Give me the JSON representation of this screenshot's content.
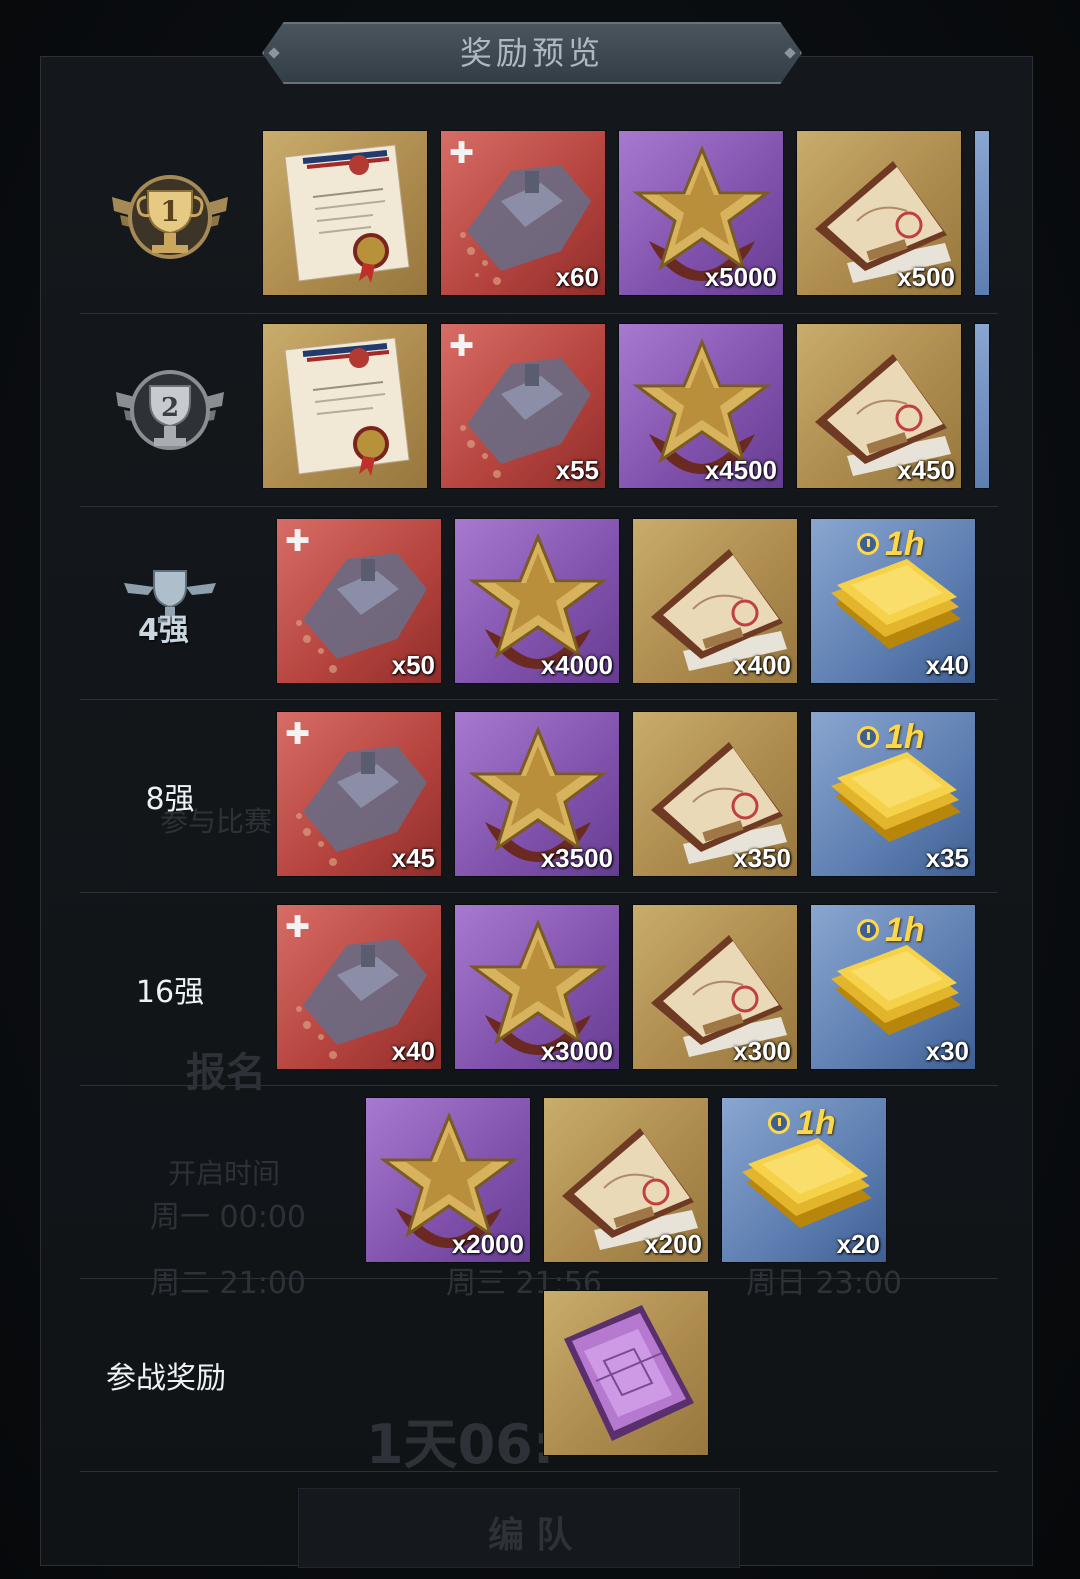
{
  "header": {
    "title": "奖励预览"
  },
  "rows": [
    {
      "rank_label": "",
      "rank_icon": "rank-1-trophy-icon",
      "items": [
        {
          "type": "commendation",
          "qty": ""
        },
        {
          "type": "ship-fragment",
          "qty": "x60"
        },
        {
          "type": "star-medal",
          "qty": "x5000"
        },
        {
          "type": "map-book",
          "qty": "x500"
        }
      ]
    },
    {
      "rank_label": "",
      "rank_icon": "rank-2-trophy-icon",
      "items": [
        {
          "type": "commendation",
          "qty": ""
        },
        {
          "type": "ship-fragment",
          "qty": "x55"
        },
        {
          "type": "star-medal",
          "qty": "x4500"
        },
        {
          "type": "map-book",
          "qty": "x450"
        }
      ]
    },
    {
      "rank_label": "4强",
      "rank_icon": "top4-trophy-icon",
      "items": [
        {
          "type": "ship-fragment",
          "qty": "x50"
        },
        {
          "type": "star-medal",
          "qty": "x4000"
        },
        {
          "type": "map-book",
          "qty": "x400"
        },
        {
          "type": "gold-speedup",
          "qty": "x40",
          "tag": "1h"
        }
      ]
    },
    {
      "rank_label": "8强",
      "items": [
        {
          "type": "ship-fragment",
          "qty": "x45"
        },
        {
          "type": "star-medal",
          "qty": "x3500"
        },
        {
          "type": "map-book",
          "qty": "x350"
        },
        {
          "type": "gold-speedup",
          "qty": "x35",
          "tag": "1h"
        }
      ]
    },
    {
      "rank_label": "16强",
      "items": [
        {
          "type": "ship-fragment",
          "qty": "x40"
        },
        {
          "type": "star-medal",
          "qty": "x3000"
        },
        {
          "type": "map-book",
          "qty": "x300"
        },
        {
          "type": "gold-speedup",
          "qty": "x30",
          "tag": "1h"
        }
      ]
    },
    {
      "rank_label": "",
      "items": [
        {
          "type": "star-medal",
          "qty": "x2000"
        },
        {
          "type": "map-book",
          "qty": "x200"
        },
        {
          "type": "gold-speedup",
          "qty": "x20",
          "tag": "1h"
        }
      ]
    },
    {
      "rank_label": "参战奖励",
      "items": [
        {
          "type": "purple-blueprint",
          "qty": ""
        }
      ]
    }
  ],
  "background_ghost_text": {
    "join": "参与比赛",
    "signup": "报名",
    "open_time": "开启时间",
    "time1": "周一 00:00",
    "time2": "周二 21:00",
    "time3": "周三 21:56",
    "time4": "周日 23:00",
    "countdown": "1天06:",
    "team_button": "编 队"
  },
  "colors": {
    "gold": "#b8965a",
    "red": "#c0504a",
    "purple": "#8a5bb5",
    "blue": "#6383b8",
    "qty_text": "#ffffff"
  }
}
